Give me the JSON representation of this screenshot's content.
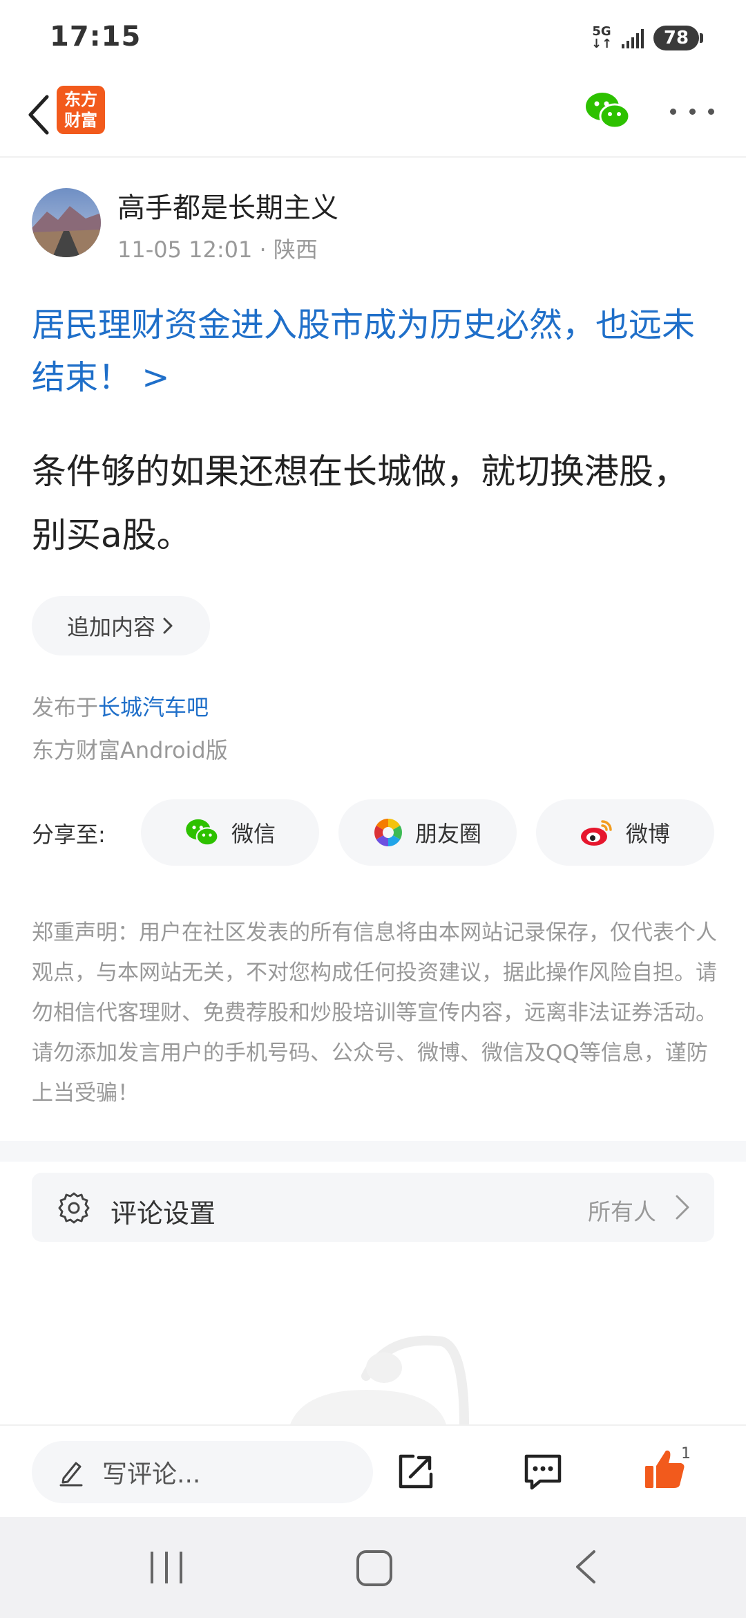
{
  "status_bar": {
    "time": "17:15",
    "network": "5G",
    "battery": "78"
  },
  "nav": {
    "logo_line1": "东方",
    "logo_line2": "财富"
  },
  "post": {
    "author": "高手都是长期主义",
    "date": "11-05 12:01",
    "location": "· 陕西",
    "headline": "居民理财资金进入股市成为历史必然，也远未结束！ >",
    "body": "条件够的如果还想在长城做，就切换港股，别买a股。",
    "append_label": "追加内容",
    "published_prefix": "发布于",
    "forum": "长城汽车吧",
    "client": "东方财富Android版"
  },
  "share": {
    "label": "分享至:",
    "options": [
      {
        "label": "微信",
        "icon": "wechat-icon"
      },
      {
        "label": "朋友圈",
        "icon": "moments-icon"
      },
      {
        "label": "微博",
        "icon": "weibo-icon"
      }
    ]
  },
  "disclaimer": "郑重声明：用户在社区发表的所有信息将由本网站记录保存，仅代表个人观点，与本网站无关，不对您构成任何投资建议，据此操作风险自担。请勿相信代客理财、免费荐股和炒股培训等宣传内容，远离非法证券活动。请勿添加发言用户的手机号码、公众号、微博、微信及QQ等信息，谨防上当受骗！",
  "comment_settings": {
    "label": "评论设置",
    "value": "所有人"
  },
  "action_bar": {
    "comment_placeholder": "写评论...",
    "like_count": "1"
  },
  "colors": {
    "accent_blue": "#1f6fc9",
    "brand_orange": "#f25a1c",
    "wechat_green": "#2dc100"
  }
}
